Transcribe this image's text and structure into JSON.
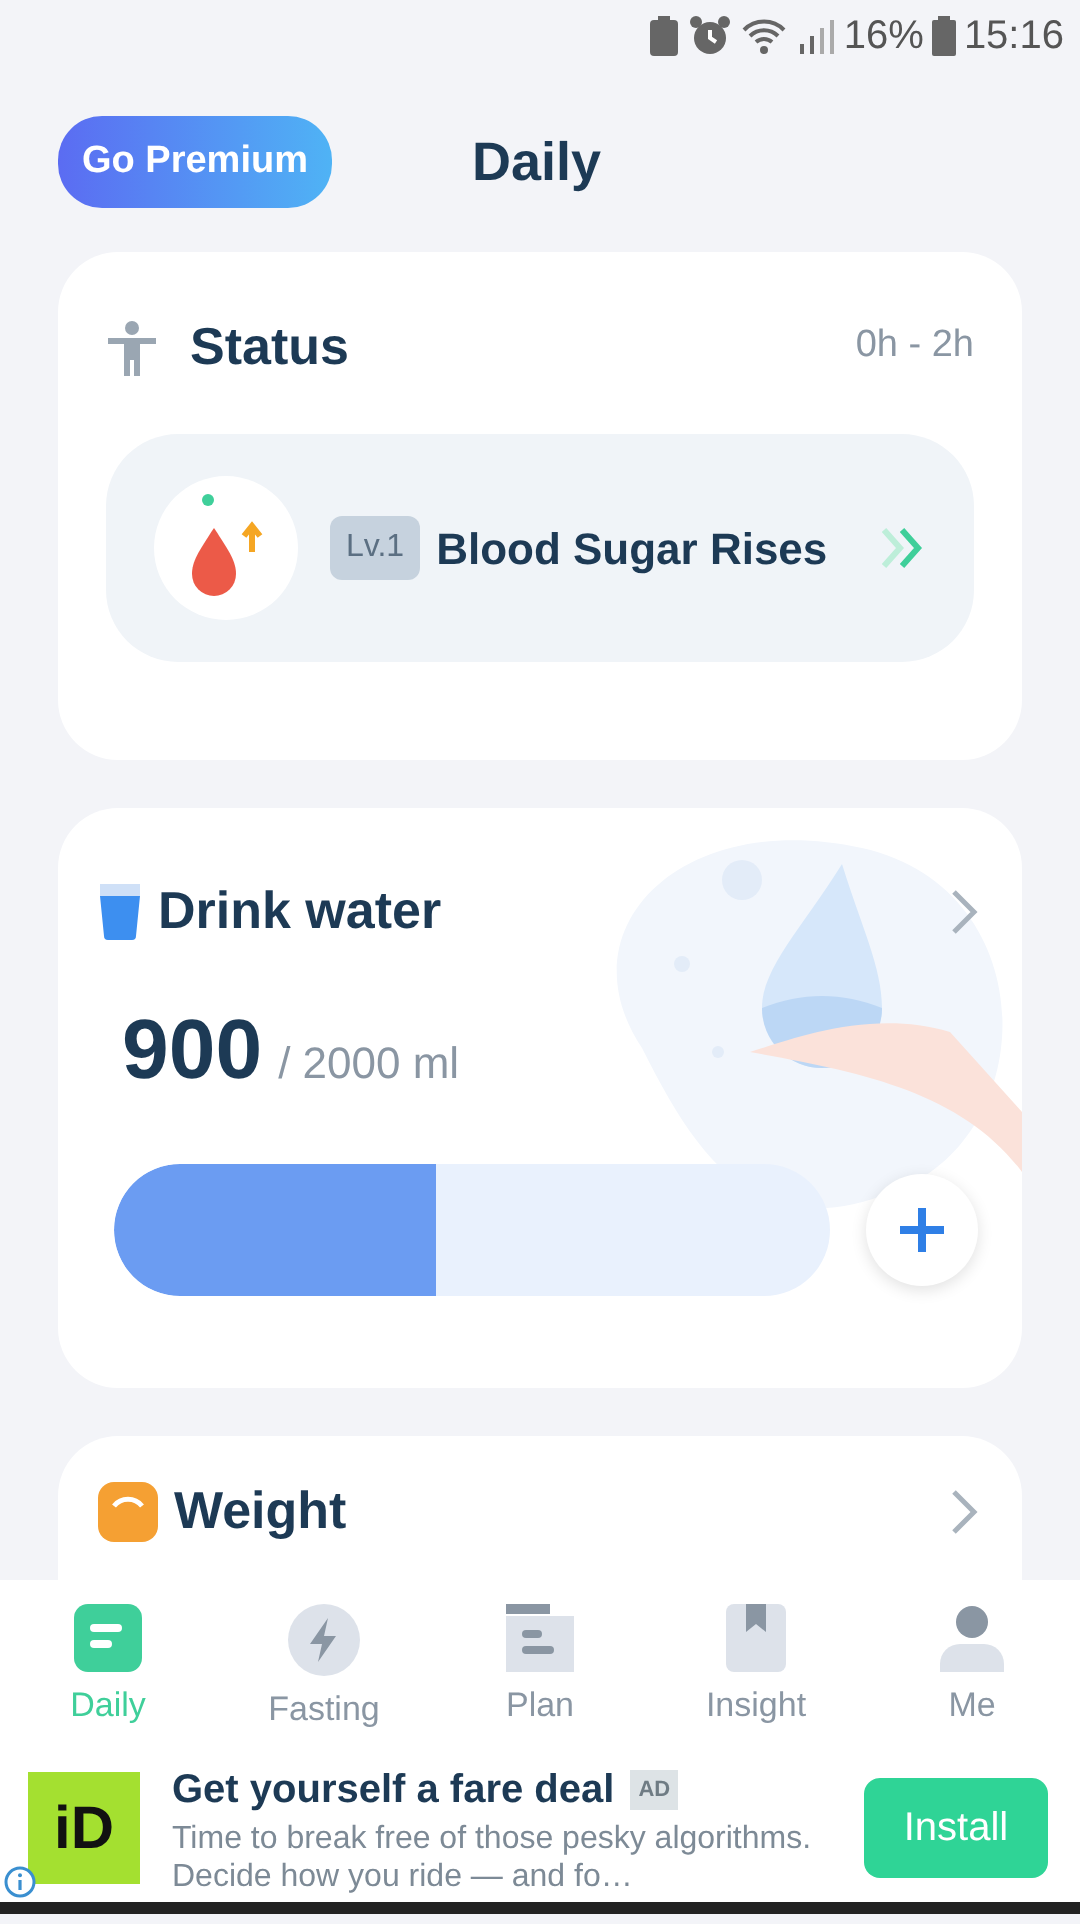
{
  "status_bar": {
    "battery": "16%",
    "time": "15:16"
  },
  "header": {
    "premium_button": "Go Premium",
    "title": "Daily"
  },
  "status_card": {
    "title": "Status",
    "range": "0h - 2h",
    "stage": {
      "level_tag": "Lv.1",
      "name": "Blood Sugar Rises"
    }
  },
  "water_card": {
    "title": "Drink water",
    "amount": "900",
    "goal": "/ 2000 ml",
    "level": 0.45
  },
  "weight_card": {
    "title": "Weight"
  },
  "tabs": [
    {
      "label": "Daily",
      "selected": true
    },
    {
      "label": "Fasting",
      "selected": false
    },
    {
      "label": "Plan",
      "selected": false
    },
    {
      "label": "Insight",
      "selected": false
    },
    {
      "label": "Me",
      "selected": false
    }
  ],
  "ad": {
    "logo_text": "iD",
    "headline": "Get yourself a fare deal",
    "badge": "AD",
    "body": "Time to break free of those pesky algorithms. Decide how you ride — and fo…",
    "button": "Install"
  }
}
